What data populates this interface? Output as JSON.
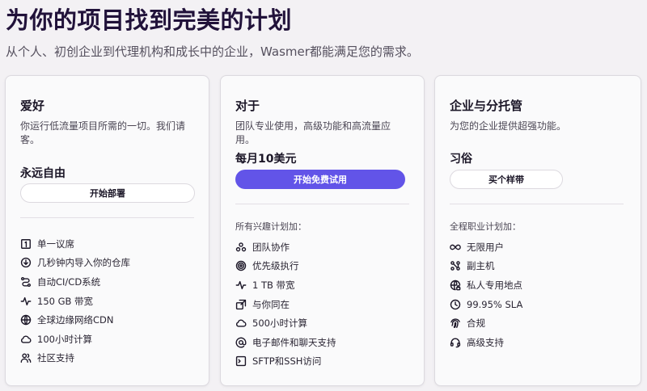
{
  "header": {
    "title": "为你的项目找到完美的计划",
    "subtitle": "从个人、初创企业到代理机构和成长中的企业，Wasmer都能满足您的需求。"
  },
  "plans": [
    {
      "title": "爱好",
      "description": "你运行低流量项目所需的一切。我们请客。",
      "price": "永远自由",
      "cta": "开始部署",
      "features_heading": "",
      "features": [
        {
          "label": "单一议席",
          "icon": "square-one-icon"
        },
        {
          "label": "几秒钟内导入你的仓库",
          "icon": "download-circle-icon"
        },
        {
          "label": "自动CI/CD系统",
          "icon": "pipeline-icon"
        },
        {
          "label": "150 GB 带宽",
          "icon": "pulse-icon"
        },
        {
          "label": "全球边缘网络CDN",
          "icon": "globe-icon"
        },
        {
          "label": "100小时计算",
          "icon": "cloud-icon"
        },
        {
          "label": "社区支持",
          "icon": "users-icon"
        }
      ]
    },
    {
      "title": "对于",
      "description": "团队专业使用，高级功能和高流量应用。",
      "price": "每月10美元",
      "cta": "开始免费试用",
      "features_heading": "所有兴趣计划加：",
      "features": [
        {
          "label": "团队协作",
          "icon": "team-icon"
        },
        {
          "label": "优先级执行",
          "icon": "target-icon"
        },
        {
          "label": "1 TB 带宽",
          "icon": "pulse-icon"
        },
        {
          "label": "与你同在",
          "icon": "external-link-icon"
        },
        {
          "label": "500小时计算",
          "icon": "cloud-icon"
        },
        {
          "label": "电子邮件和聊天支持",
          "icon": "at-icon"
        },
        {
          "label": "SFTP和SSH访问",
          "icon": "terminal-icon"
        }
      ]
    },
    {
      "title": "企业与分托管",
      "description": "为您的企业提供超强功能。",
      "price": "习俗",
      "cta": "买个样带",
      "features_heading": "全程职业计划加：",
      "features": [
        {
          "label": "无限用户",
          "icon": "infinity-icon"
        },
        {
          "label": "副主机",
          "icon": "nodes-icon"
        },
        {
          "label": "私人专用地点",
          "icon": "globe-lock-icon"
        },
        {
          "label": "99.95% SLA",
          "icon": "clock-icon"
        },
        {
          "label": "合规",
          "icon": "fingerprint-icon"
        },
        {
          "label": "高级支持",
          "icon": "headset-icon"
        }
      ]
    }
  ],
  "colors": {
    "accent": "#6254e8",
    "title": "#21123a",
    "background": "#f3f1f4"
  }
}
